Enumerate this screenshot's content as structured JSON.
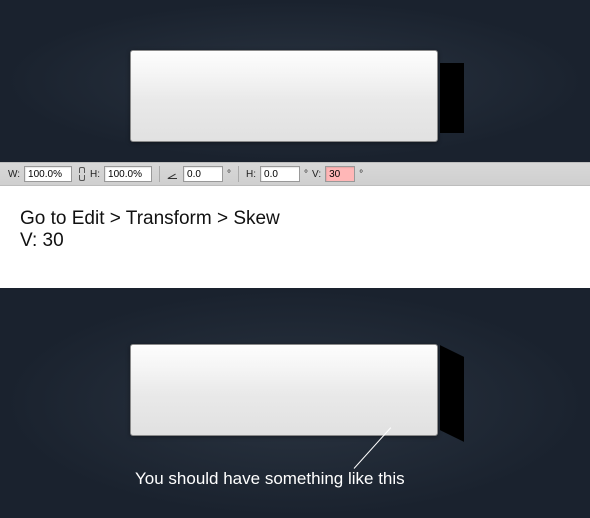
{
  "optionsBar": {
    "w_label": "W:",
    "w_value": "100.0%",
    "h_label": "H:",
    "h_value": "100.0%",
    "angle_value": "0.0",
    "skew_h_label": "H:",
    "skew_h_value": "0.0",
    "skew_v_label": "V:",
    "skew_v_value": "30",
    "degree": "°"
  },
  "instruction": {
    "line1": "Go to Edit > Transform > Skew",
    "line2": "V: 30"
  },
  "caption": "You should have something like this"
}
